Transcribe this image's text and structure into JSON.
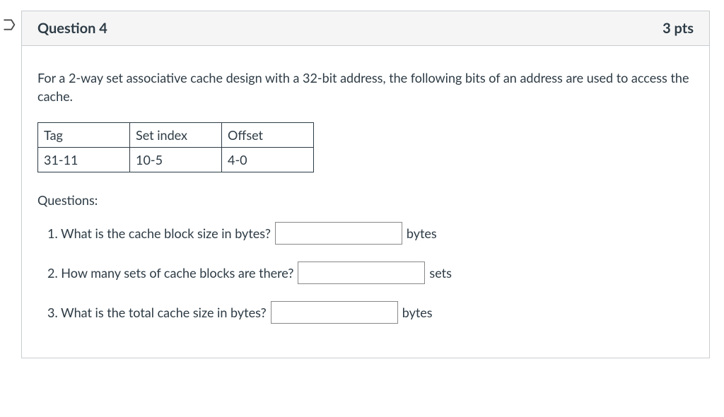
{
  "header": {
    "title": "Question 4",
    "points": "3 pts"
  },
  "intro": "For a 2-way set associative cache design with a 32-bit address, the following bits of an address are used to access the cache.",
  "table": {
    "headers": {
      "tag": "Tag",
      "index": "Set index",
      "offset": "Offset"
    },
    "values": {
      "tag": "31-11",
      "index": "10-5",
      "offset": "4-0"
    }
  },
  "questions_label": "Questions:",
  "q1": {
    "text": "1. What is the cache block size in bytes?",
    "unit": "bytes"
  },
  "q2": {
    "text": "2. How many sets of cache blocks are there?",
    "unit": "sets"
  },
  "q3": {
    "text": "3. What is the total cache size in bytes?",
    "unit": "bytes"
  }
}
